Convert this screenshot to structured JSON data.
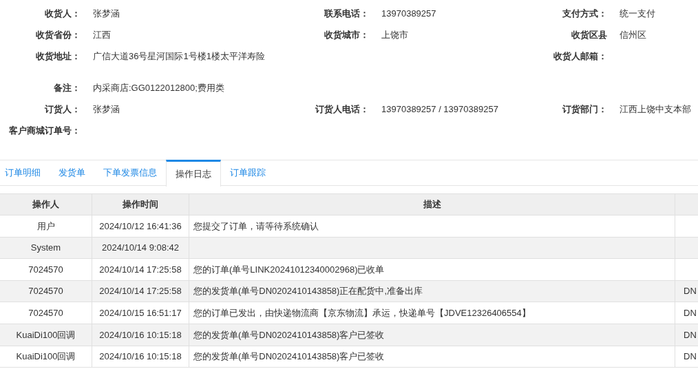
{
  "info_rows": [
    [
      {
        "label": "收货人：",
        "value": "张梦涵"
      },
      {
        "label": "联系电话：",
        "value": "13970389257"
      },
      {
        "label": "支付方式：",
        "value": "统一支付"
      }
    ],
    [
      {
        "label": "收货省份：",
        "value": "江西"
      },
      {
        "label": "收货城市：",
        "value": "上饶市"
      },
      {
        "label": "收货区县",
        "value": "信州区"
      }
    ],
    [
      {
        "label": "收货地址：",
        "value": "广信大道36号星河国际1号楼1楼太平洋寿险"
      },
      null,
      {
        "label": "收货人邮箱："
      }
    ],
    [
      {
        "label": "备注：",
        "value": "内采商店:GG0122012800;费用类"
      },
      null,
      null
    ],
    [
      {
        "label": "订货人：",
        "value": "张梦涵"
      },
      {
        "label": "订货人电话：",
        "value": "13970389257 / 13970389257"
      },
      {
        "label": "订货部门：",
        "value": "江西上饶中支本部"
      }
    ],
    [
      {
        "label": "客户商城订单号："
      },
      null,
      null
    ]
  ],
  "tabs": [
    {
      "label": "订单明细",
      "selected": false
    },
    {
      "label": "发货单",
      "selected": false
    },
    {
      "label": "下单发票信息",
      "selected": false
    },
    {
      "label": "操作日志",
      "selected": true
    },
    {
      "label": "订单跟踪",
      "selected": false
    }
  ],
  "table": {
    "columns": [
      "操作人",
      "操作时间",
      "描述"
    ],
    "rows": [
      {
        "operator": "用户",
        "time": "2024/10/12 16:41:36",
        "description": "您提交了订单，请等待系统确认"
      },
      {
        "operator": "System",
        "time": "2024/10/14 9:08:42"
      },
      {
        "operator": "7024570",
        "time": "2024/10/14 17:25:58",
        "description": "您的订单(单号LINK20241012340002968)已收单"
      },
      {
        "operator": "7024570",
        "time": "2024/10/14 17:25:58",
        "description": "您的发货单(单号DN0202410143858)正在配货中,准备出库",
        "column_4": "DN"
      },
      {
        "operator": "7024570",
        "time": "2024/10/15 16:51:17",
        "description": "您的订单已发出，由快递物流商【京东物流】承运，快递单号【JDVE12326406554】",
        "column_4": "DN"
      },
      {
        "operator": "KuaiDi100回调",
        "time": "2024/10/16 10:15:18",
        "description": "您的发货单(单号DN0202410143858)客户已签收",
        "column_4": "DN"
      },
      {
        "operator": "KuaiDi100回调",
        "time": "2024/10/16 10:15:18",
        "description": "您的发货单(单号DN0202410143858)客户已签收",
        "column_4": "DN"
      }
    ]
  }
}
